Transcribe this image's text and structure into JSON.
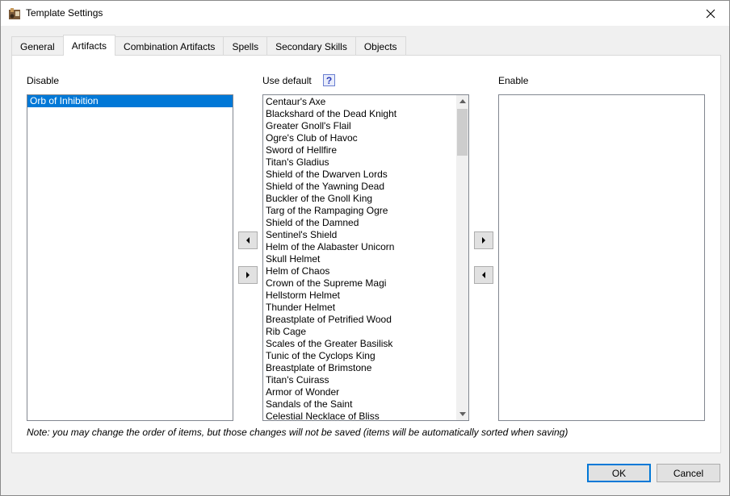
{
  "window": {
    "title": "Template Settings"
  },
  "tabs": [
    {
      "label": "General"
    },
    {
      "label": "Artifacts"
    },
    {
      "label": "Combination Artifacts"
    },
    {
      "label": "Spells"
    },
    {
      "label": "Secondary Skills"
    },
    {
      "label": "Objects"
    }
  ],
  "active_tab": "Artifacts",
  "disable": {
    "label": "Disable",
    "items": [
      "Orb of Inhibition"
    ],
    "selected": "Orb of Inhibition"
  },
  "use_default": {
    "label": "Use default",
    "help_icon": "question-mark-icon",
    "items": [
      "Centaur's Axe",
      "Blackshard of the Dead Knight",
      "Greater Gnoll's Flail",
      "Ogre's Club of Havoc",
      "Sword of Hellfire",
      "Titan's Gladius",
      "Shield of the Dwarven Lords",
      "Shield of the Yawning Dead",
      "Buckler of the Gnoll King",
      "Targ of the Rampaging Ogre",
      "Shield of the Damned",
      "Sentinel's Shield",
      "Helm of the Alabaster Unicorn",
      "Skull Helmet",
      "Helm of Chaos",
      "Crown of the Supreme Magi",
      "Hellstorm Helmet",
      "Thunder Helmet",
      "Breastplate of Petrified Wood",
      "Rib Cage",
      "Scales of the Greater Basilisk",
      "Tunic of the Cyclops King",
      "Breastplate of Brimstone",
      "Titan's Cuirass",
      "Armor of Wonder",
      "Sandals of the Saint",
      "Celestial Necklace of Bliss"
    ]
  },
  "enable": {
    "label": "Enable",
    "items": []
  },
  "note": "Note: you may change the order of items, but those changes will not be saved (items will be automatically sorted when saving)",
  "buttons": {
    "ok": "OK",
    "cancel": "Cancel"
  },
  "colors": {
    "selection": "#0078d7",
    "default_button_border": "#0078d7"
  }
}
